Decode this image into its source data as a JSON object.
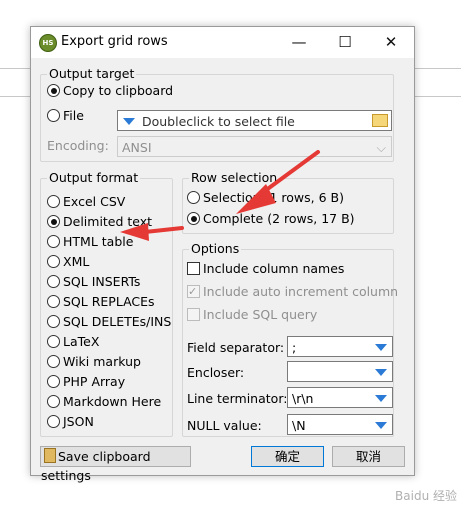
{
  "window": {
    "title": "Export grid rows",
    "app_icon": "heidisql-icon"
  },
  "output_target": {
    "label": "Output target",
    "copy_label": "Copy to clipboard",
    "file_label": "File",
    "file_placeholder": "Doubleclick to select file",
    "encoding_label": "Encoding:",
    "encoding_value": "ANSI",
    "selected": "copy"
  },
  "output_format": {
    "label": "Output format",
    "selected": "Delimited text",
    "items": [
      "Excel CSV",
      "Delimited text",
      "HTML table",
      "XML",
      "SQL INSERTs",
      "SQL REPLACEs",
      "SQL DELETEs/INSE",
      "LaTeX",
      "Wiki markup",
      "PHP Array",
      "Markdown Here",
      "JSON"
    ]
  },
  "row_selection": {
    "label": "Row selection",
    "selection": "Selection (1 rows, 6 B)",
    "complete": "Complete (2 rows, 17 B)",
    "selected": "complete"
  },
  "options": {
    "label": "Options",
    "include_column_names": "Include column names",
    "include_auto_increment": "Include auto increment column",
    "include_sql_query": "Include SQL query",
    "field_separator_label": "Field separator:",
    "field_separator_value": ";",
    "encloser_label": "Encloser:",
    "encloser_value": "",
    "line_terminator_label": "Line terminator:",
    "line_terminator_value": "\\r\\n",
    "null_value_label": "NULL value:",
    "null_value_value": "\\N"
  },
  "buttons": {
    "save_settings": "Save clipboard settings",
    "ok": "确定",
    "cancel": "取消"
  },
  "annotation_color": "#e53935",
  "watermark": "Baidu 经验"
}
